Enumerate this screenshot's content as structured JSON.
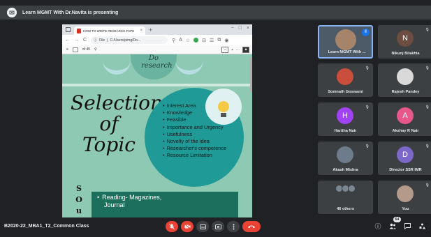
{
  "topbar": {
    "presenting_text": "Learn MGMT With Dr.Navita is presenting",
    "icon": "presenting-icon"
  },
  "browser": {
    "tab_title": "HOW TO WRITE RESEARCH PAPE",
    "tab_close": "×",
    "new_tab": "+",
    "window_controls": [
      "−",
      "□",
      "×"
    ],
    "nav": {
      "back": "←",
      "forward": "→",
      "reload": "C"
    },
    "url_label": "File",
    "url": "C:/Users/pimg/Do...",
    "pdf": {
      "page_indicator": "of 45",
      "zoom_out": "−",
      "zoom_in": "+",
      "more": "···"
    }
  },
  "slide": {
    "bubble_text": "Do research",
    "heading": "Selection of Topic",
    "criteria": [
      "Interest Area",
      "Knowledge",
      "Feasible",
      "Importance and Urgency",
      "Usefulness",
      "Novelty of the idea",
      "Researcher's competence",
      "Resource Limitation"
    ],
    "side_letters": [
      "S",
      "O",
      "u"
    ],
    "reading_line1": "Reading- Magazines,",
    "reading_line2": "Journal"
  },
  "participants": [
    {
      "name": "Learn MGMT With ...",
      "initial": "",
      "color": "#a5846a",
      "photo": true,
      "speaking": true
    },
    {
      "name": "Nikunj Bilakhia",
      "initial": "N",
      "color": "#6d4c41",
      "photo": false,
      "speaking": false
    },
    {
      "name": "Somnath Goswami",
      "initial": "",
      "color": "#c94f3c",
      "photo": true,
      "speaking": false
    },
    {
      "name": "Rajesh Pandey",
      "initial": "",
      "color": "#d9d9d9",
      "photo": true,
      "speaking": false
    },
    {
      "name": "Haritha Nair",
      "initial": "H",
      "color": "#a142f4",
      "photo": false,
      "speaking": false
    },
    {
      "name": "Akshay R Nair",
      "initial": "A",
      "color": "#e8578a",
      "photo": false,
      "speaking": false
    },
    {
      "name": "Akash Mishra",
      "initial": "",
      "color": "#6d7b8a",
      "photo": true,
      "speaking": false
    },
    {
      "name": "Director SSR IMR",
      "initial": "D",
      "color": "#7b68c8",
      "photo": false,
      "speaking": false
    },
    {
      "name": "46 others",
      "initial": "",
      "color": "#7a8793",
      "photo": true,
      "speaking": false
    },
    {
      "name": "You",
      "initial": "",
      "color": "#b39a8a",
      "photo": true,
      "speaking": false
    }
  ],
  "bottom": {
    "meeting_name": "B2020-22_MBA1_T2_Common Class",
    "people_count": "64"
  },
  "colors": {
    "accent": "#1a73e8",
    "danger": "#ea4335",
    "slide_bg": "#8ec9b3",
    "teal_circle": "#1f9a96"
  }
}
